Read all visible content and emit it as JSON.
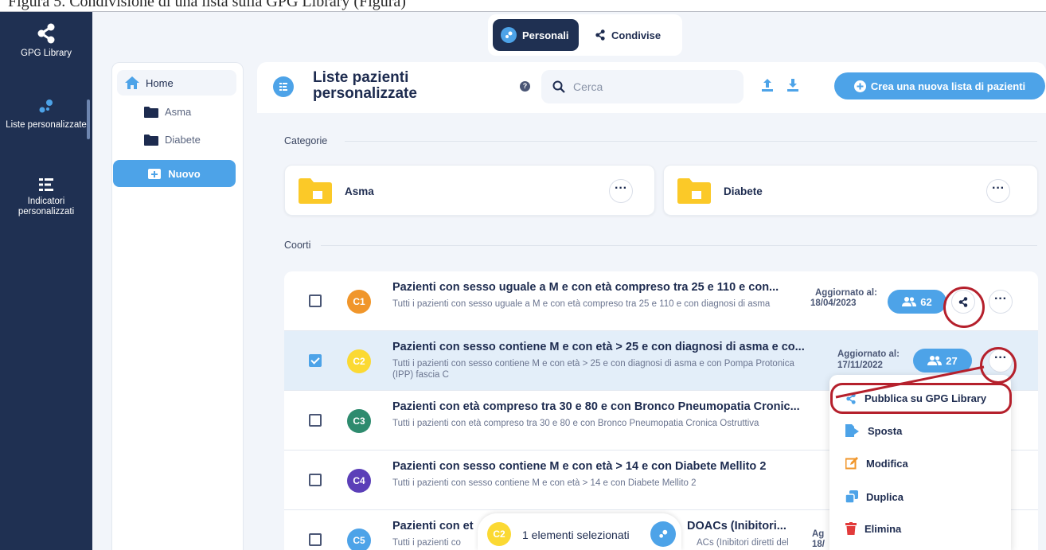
{
  "caption": "Figura 5.   Condivisione di una lista sulla GPG Library (Figura)",
  "rail": {
    "library_label": "GPG Library",
    "lists_label": "Liste personalizzate",
    "indicators_label": "Indicatori personalizzati"
  },
  "segmented": {
    "personal": "Personali",
    "shared": "Condivise"
  },
  "tree": {
    "home": "Home",
    "folders": [
      "Asma",
      "Diabete"
    ],
    "new_label": "Nuovo"
  },
  "header": {
    "title": "Liste pazienti personalizzate",
    "help": "?",
    "search_placeholder": "Cerca",
    "create_label": "Crea una nuova lista di pazienti"
  },
  "sections": {
    "categories": "Categorie",
    "cohorts": "Coorti"
  },
  "categories": [
    {
      "name": "Asma",
      "more": "···"
    },
    {
      "name": "Diabete",
      "more": "···"
    }
  ],
  "rows": [
    {
      "code": "C1",
      "color": "#f0962b",
      "checked": false,
      "title": "Pazienti con sesso uguale a M e con età compreso tra 25 e 110 e con...",
      "subtitle": "Tutti i pazienti con sesso uguale a M e con età compreso tra 25 e 110 e con diagnosi di asma",
      "updated_label": "Aggiornato al:",
      "updated_date": "18/04/2023",
      "count": "62"
    },
    {
      "code": "C2",
      "color": "#fbd933",
      "checked": true,
      "title": "Pazienti con sesso contiene M e con età > 25 e con diagnosi di asma e co...",
      "subtitle": "Tutti i pazienti con sesso contiene M e con età > 25 e con diagnosi di asma e con Pompa Protonica (IPP) fascia C",
      "updated_label": "Aggiornato al:",
      "updated_date": "17/11/2022",
      "count": "27"
    },
    {
      "code": "C3",
      "color": "#2e8b6e",
      "checked": false,
      "title": "Pazienti con età compreso tra 30 e 80 e con Bronco Pneumopatia Cronic...",
      "subtitle": "Tutti i pazienti con età compreso tra 30 e 80 e con Bronco Pneumopatia Cronica Ostruttiva"
    },
    {
      "code": "C4",
      "color": "#5b3fb8",
      "checked": false,
      "title": "Pazienti con sesso contiene M e con età > 14 e con Diabete Mellito 2",
      "subtitle": "Tutti i pazienti con sesso contiene M e con età > 14 e con Diabete Mellito 2"
    },
    {
      "code": "C5",
      "color": "#4da3e8",
      "checked": false,
      "title_a": "Pazienti con et",
      "title_b": "DOACs (Inibitori...",
      "subtitle_a": "Tutti i pazienti co",
      "subtitle_b": "ACs (Inibitori diretti del",
      "updated_a": "Ag",
      "updated_b": "18/"
    }
  ],
  "menu": {
    "items": [
      "Pubblica su GPG Library",
      "Sposta",
      "Modifica",
      "Duplica",
      "Elimina"
    ],
    "colors": {
      "share": "#4da3e8",
      "edit": "#f0962b",
      "delete": "#e23b3b"
    }
  },
  "toast": {
    "badge": "C2",
    "text": "1 elementi selezionati"
  },
  "colors": {
    "sidebar": "#1f3052",
    "accent": "#4da3e8",
    "highlight": "#b5202c"
  }
}
